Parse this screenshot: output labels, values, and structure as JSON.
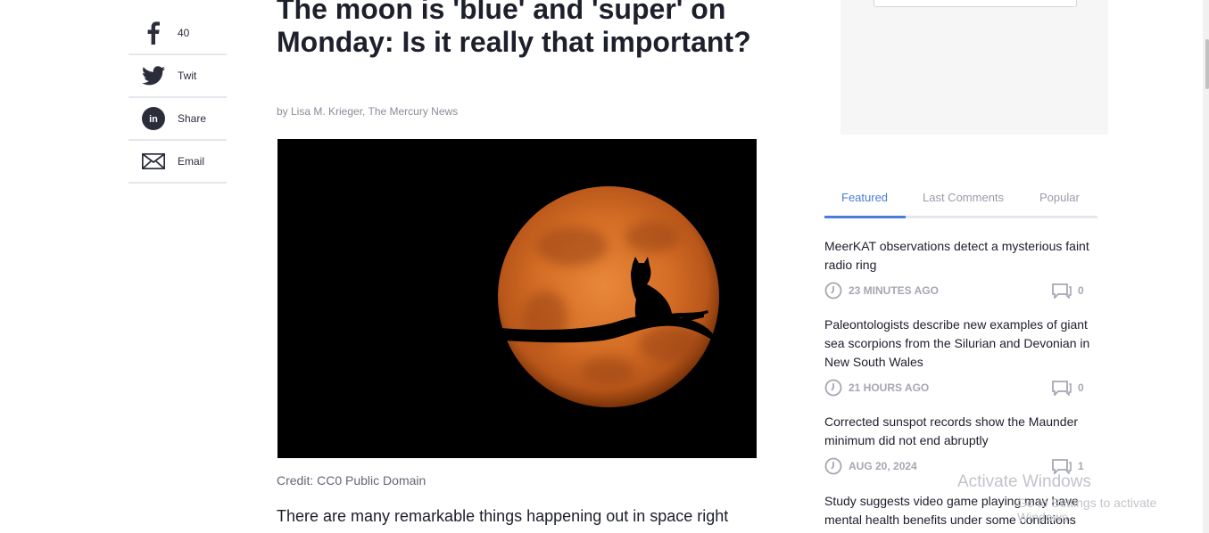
{
  "share": {
    "items": [
      {
        "icon": "facebook-icon",
        "label": "40"
      },
      {
        "icon": "twitter-icon",
        "label": "Twit"
      },
      {
        "icon": "linkedin-icon",
        "label": "Share"
      },
      {
        "icon": "email-icon",
        "label": "Email"
      }
    ]
  },
  "article": {
    "headline": "The moon is 'blue' and 'super' on Monday: Is it really that important?",
    "byline": "by Lisa M. Krieger, The Mercury News",
    "image_credit": "Credit: CC0 Public Domain",
    "lead": "There are many remarkable things happening out in space right"
  },
  "sidebar": {
    "tabs": [
      "Featured",
      "Last Comments",
      "Popular"
    ],
    "active_tab": "Featured",
    "accent_color": "#4a7dd4",
    "items": [
      {
        "title": "MeerKAT observations detect a mysterious faint radio ring",
        "time": "23 MINUTES AGO",
        "comments": "0"
      },
      {
        "title": "Paleontologists describe new examples of giant sea scorpions from the Silurian and Devonian in New South Wales",
        "time": "21 HOURS AGO",
        "comments": "0"
      },
      {
        "title": "Corrected sunspot records show the Maunder minimum did not end abruptly",
        "time": "AUG 20, 2024",
        "comments": "1"
      },
      {
        "title": "Study suggests video game playing may have mental health benefits under some conditions",
        "time": "",
        "comments": ""
      }
    ]
  },
  "watermark": {
    "line1": "Activate Windows",
    "line2": "Go to Settings to activate Windows."
  }
}
